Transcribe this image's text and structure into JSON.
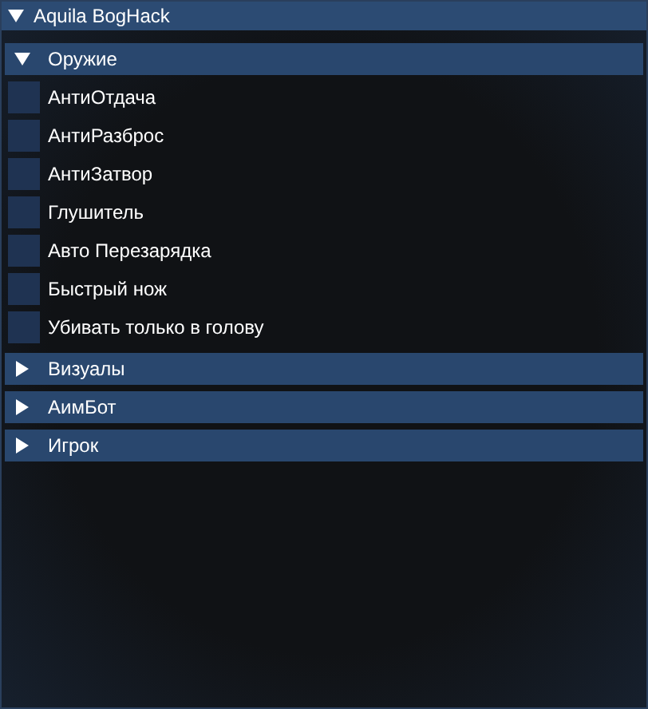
{
  "window": {
    "title": "Aquila BogHack",
    "expanded": true
  },
  "sections": [
    {
      "label": "Оружие",
      "expanded": true,
      "items": [
        {
          "label": "АнтиОтдача",
          "checked": false
        },
        {
          "label": "АнтиРазброс",
          "checked": false
        },
        {
          "label": "АнтиЗатвор",
          "checked": false
        },
        {
          "label": "Глушитель",
          "checked": false
        },
        {
          "label": "Авто Перезарядка",
          "checked": false
        },
        {
          "label": "Быстрый нож",
          "checked": false
        },
        {
          "label": "Убивать только в голову",
          "checked": false
        }
      ]
    },
    {
      "label": "Визуалы",
      "expanded": false
    },
    {
      "label": "АимБот",
      "expanded": false
    },
    {
      "label": "Игрок",
      "expanded": false
    }
  ]
}
